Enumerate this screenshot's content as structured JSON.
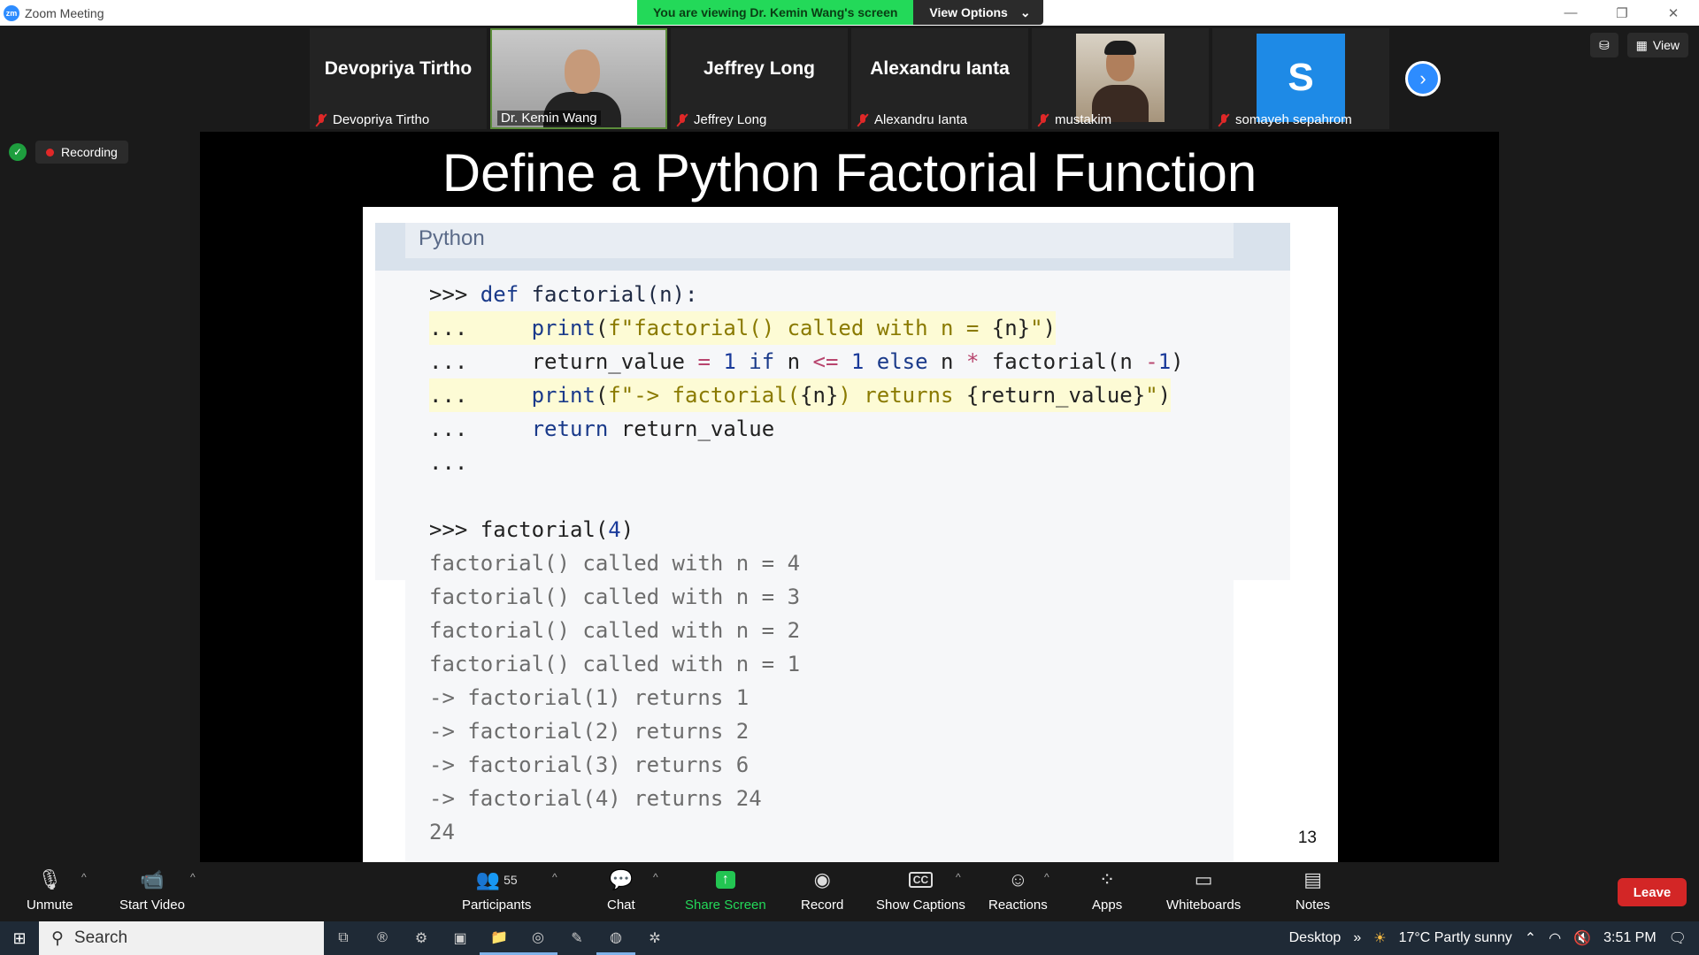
{
  "window": {
    "app_title": "Zoom Meeting",
    "logo": "zm"
  },
  "share_banner": {
    "message": "You are viewing Dr. Kemin Wang's screen",
    "view_options": "View Options"
  },
  "gallery": {
    "tiles": [
      {
        "big_name": "Devopriya Tirtho",
        "label": "Devopriya Tirtho",
        "muted": true
      },
      {
        "label": "Dr. Kemin Wang",
        "muted": false,
        "video": true
      },
      {
        "big_name": "Jeffrey Long",
        "label": "Jeffrey Long",
        "muted": true
      },
      {
        "big_name": "Alexandru Ianta",
        "label": "Alexandru Ianta",
        "muted": true
      },
      {
        "label": "mustakim",
        "muted": true,
        "photo": true
      },
      {
        "label": "somayeh sepahrom",
        "muted": true,
        "avatar_letter": "S"
      }
    ]
  },
  "top_right": {
    "view_label": "View"
  },
  "recording": {
    "label": "Recording"
  },
  "slide": {
    "title": "Define a Python Factorial Function",
    "code_lang": "Python",
    "page_number": "13"
  },
  "toolbar": {
    "unmute": "Unmute",
    "start_video": "Start Video",
    "participants": "Participants",
    "participants_count": "55",
    "chat": "Chat",
    "share_screen": "Share Screen",
    "record": "Record",
    "captions": "Show Captions",
    "reactions": "Reactions",
    "apps": "Apps",
    "whiteboards": "Whiteboards",
    "notes": "Notes",
    "leave": "Leave"
  },
  "taskbar": {
    "search": "Search",
    "desktop": "Desktop",
    "weather": "17°C  Partly sunny",
    "time": "3:51 PM"
  }
}
